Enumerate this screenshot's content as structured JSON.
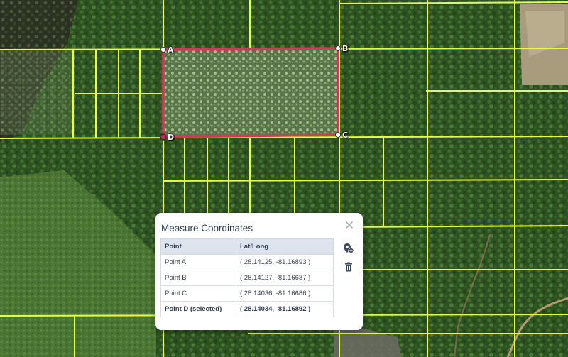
{
  "panel": {
    "title": "Measure Coordinates",
    "close_icon": "close-icon",
    "add_icon": "add-location-icon",
    "delete_icon": "trash-icon"
  },
  "table": {
    "headers": [
      "Point",
      "Lat/Long"
    ],
    "rows": [
      {
        "point": "Point A",
        "latlong": "( 28.14125, -81.16893 )"
      },
      {
        "point": "Point B",
        "latlong": "( 28.14127, -81.16687 )"
      },
      {
        "point": "Point C",
        "latlong": "( 28.14036, -81.16686 )"
      },
      {
        "point": "Point D (selected)",
        "latlong": "( 28.14034, -81.16892 )"
      }
    ]
  },
  "map": {
    "points": [
      {
        "label": "A"
      },
      {
        "label": "B"
      },
      {
        "label": "C"
      },
      {
        "label": "D"
      }
    ],
    "colors": {
      "parcel_lines": "#e6ff3a",
      "measure_outline": "#d03a5a",
      "vegetation": "#2f5323"
    }
  }
}
